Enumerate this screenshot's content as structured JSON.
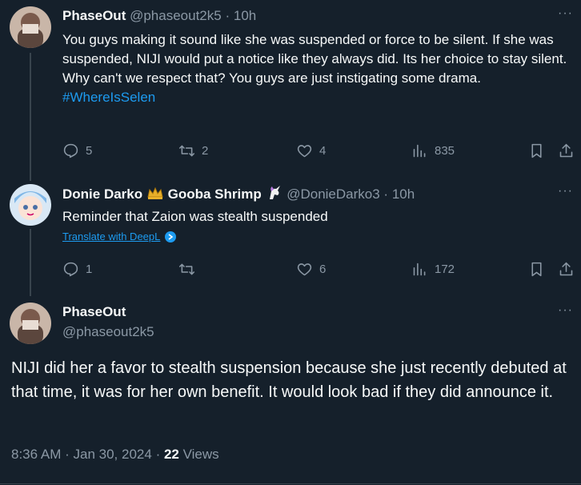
{
  "tweets": [
    {
      "display_name": "PhaseOut",
      "handle": "@phaseout2k5",
      "time": "10h",
      "text": "You guys making it sound like she was  suspended or force to be silent. If she was suspended, NIJI would put a notice like they always did. Its her choice to stay silent. Why can't we respect that? You guys are just instigating some drama.",
      "hashtag": "#WhereIsSelen",
      "replies": "5",
      "reposts": "2",
      "likes": "4",
      "views": "835"
    },
    {
      "display_name": "Donie Darko",
      "display_name_2": "Gooba Shrimp",
      "handle": "@DonieDarko3",
      "time": "10h",
      "text": "Reminder that Zaion was stealth suspended",
      "translate": "Translate with DeepL",
      "replies": "1",
      "reposts": "",
      "likes": "6",
      "views": "172"
    }
  ],
  "main_tweet": {
    "display_name": "PhaseOut",
    "handle": "@phaseout2k5",
    "text": "NIJI did her a favor to stealth suspension because she just recently debuted at that time, it was for her own benefit. It would look bad if they did announce it.",
    "time": "8:36 AM",
    "date": "Jan 30, 2024",
    "views_count": "22",
    "views_label": "Views"
  },
  "separator": "·",
  "more_icon": "···",
  "colors": {
    "background": "#15202b",
    "text": "#f7f9f9",
    "muted": "#8b98a5",
    "link": "#1d9bf0",
    "border": "#38444d"
  },
  "icons": [
    "reply-icon",
    "repost-icon",
    "like-icon",
    "views-icon",
    "bookmark-icon",
    "share-icon",
    "more-icon",
    "crown-emoji-icon",
    "unicorn-emoji-icon",
    "deepl-icon"
  ]
}
